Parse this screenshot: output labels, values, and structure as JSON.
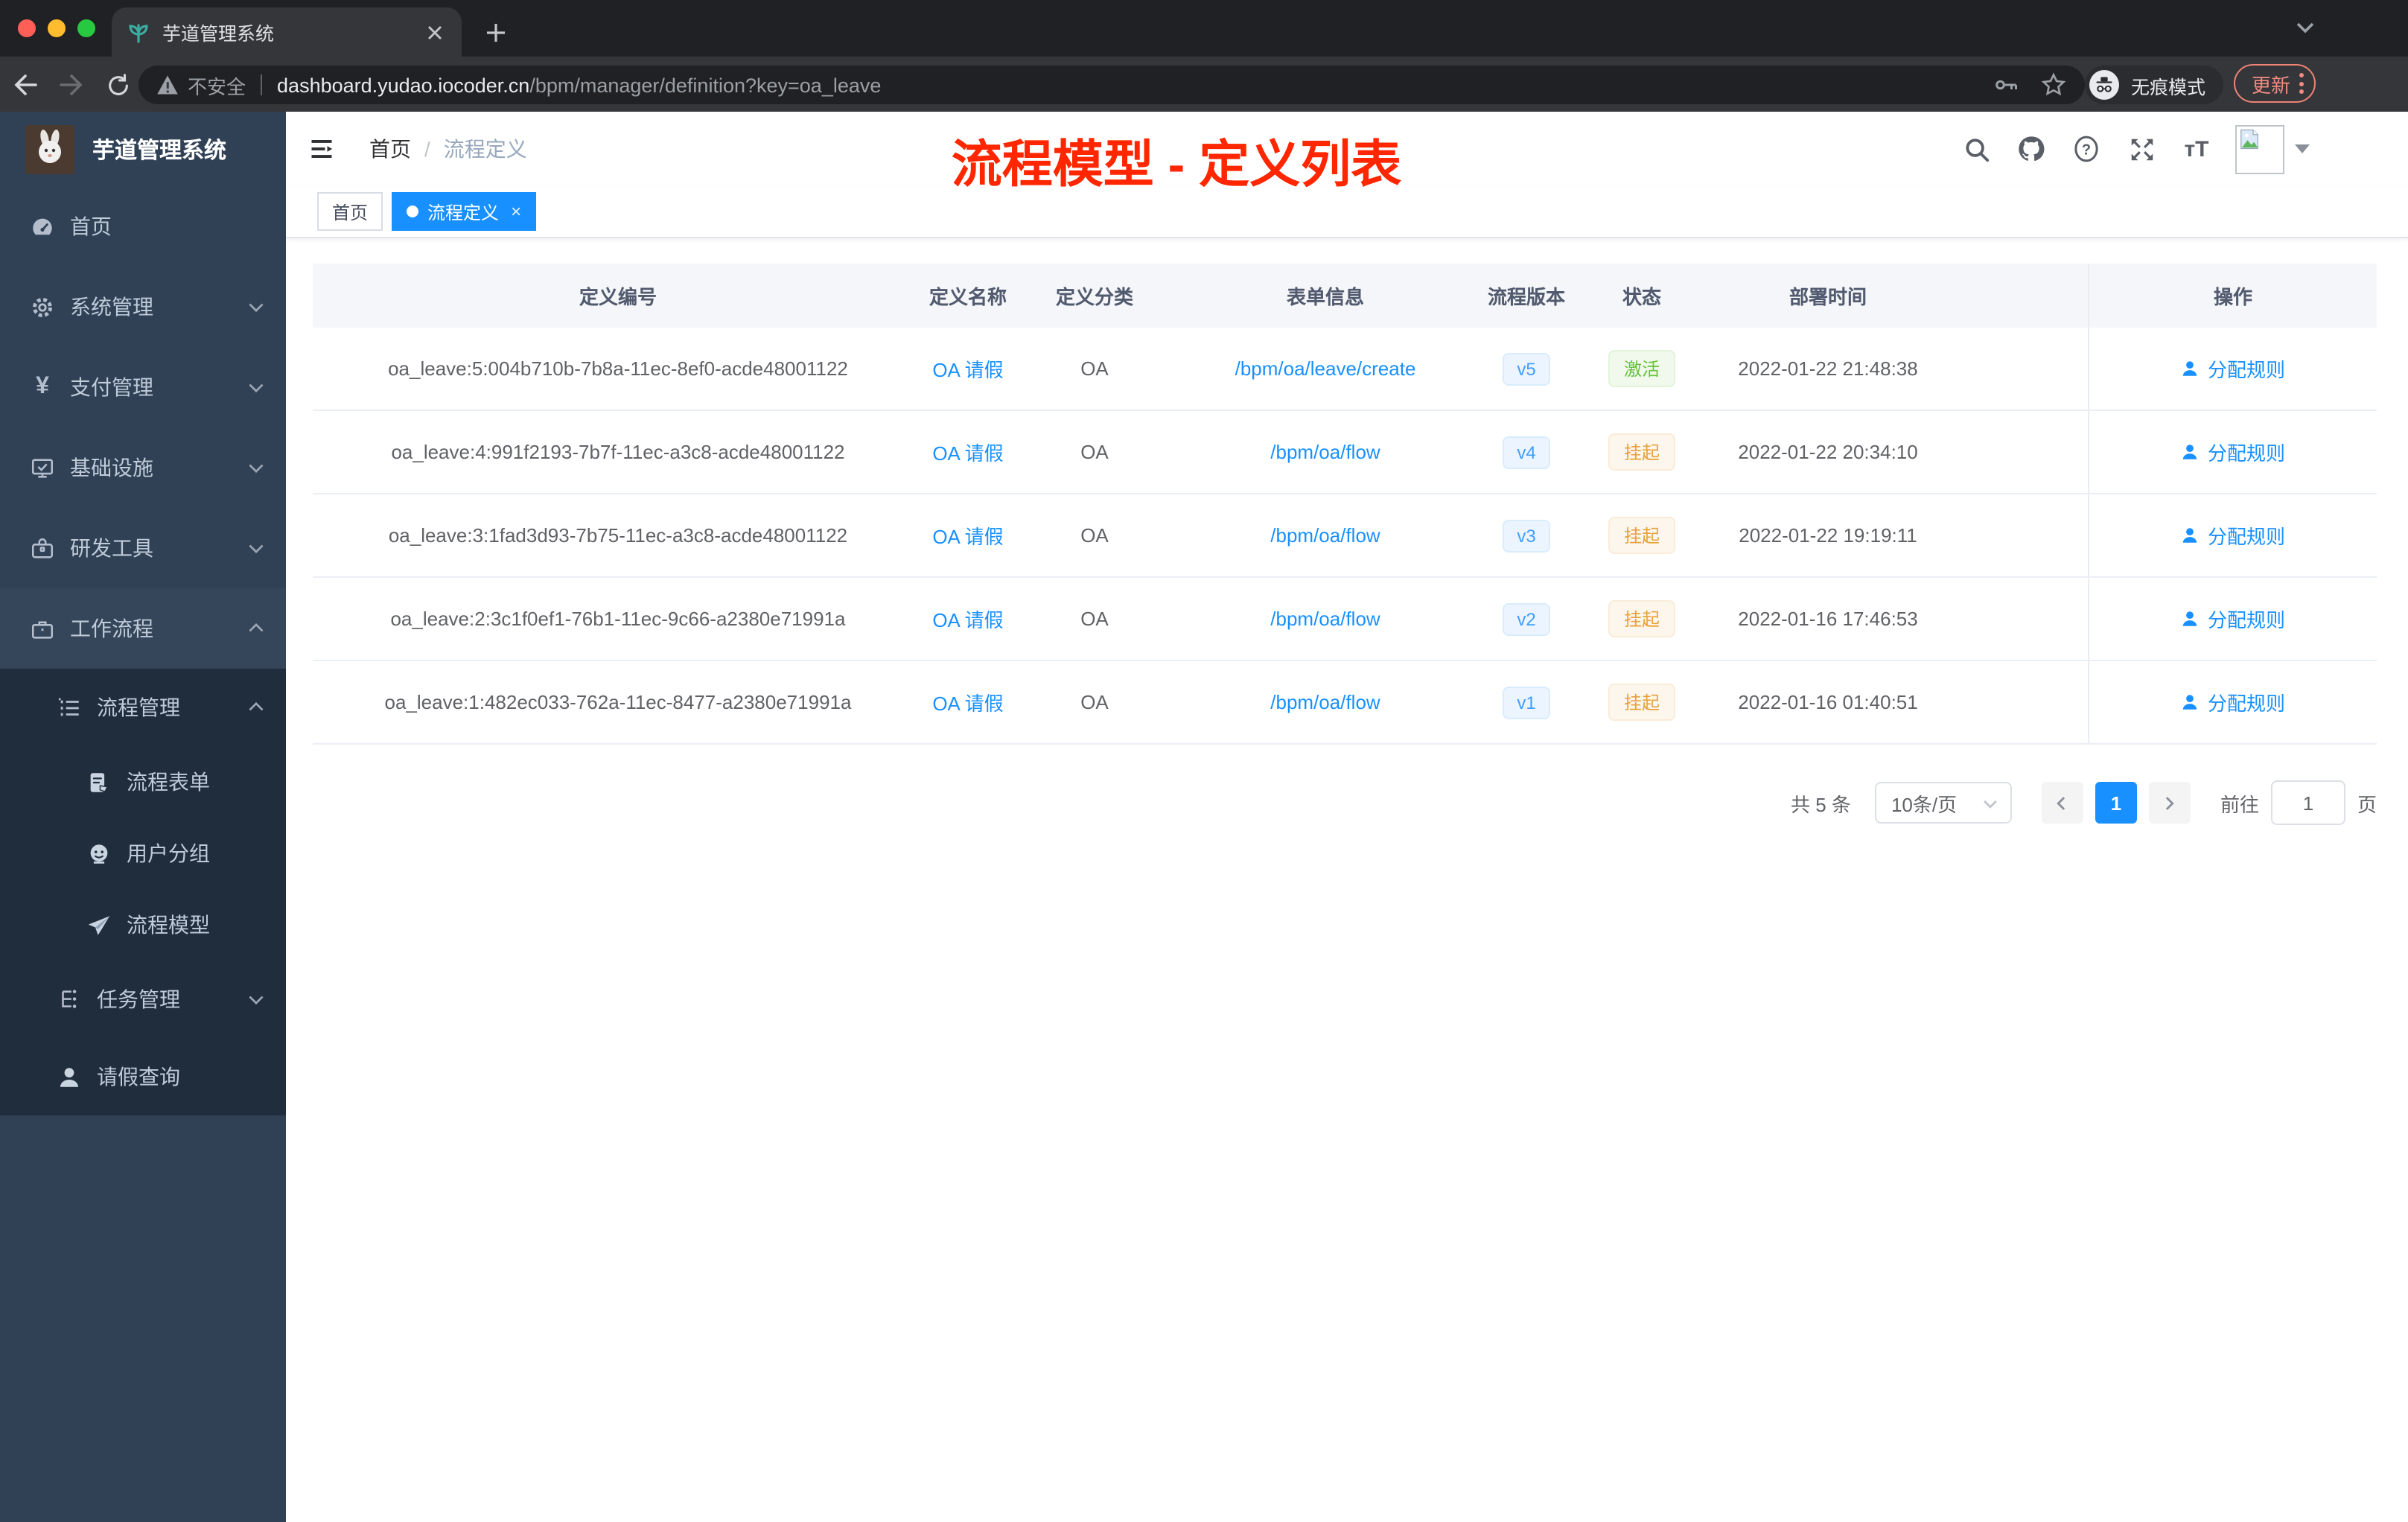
{
  "colors": {
    "accent": "#1890ff",
    "success": "#67c23a",
    "warning": "#e6a23c",
    "annotation_red": "#ff2600",
    "sidebar_bg": "#304156",
    "submenu_bg": "#1f2d3d"
  },
  "browser": {
    "tab_title": "芋道管理系统",
    "security_label": "不安全",
    "url_domain": "dashboard.yudao.iocoder.cn",
    "url_path": "/bpm/manager/definition?key=oa_leave",
    "incognito_label": "无痕模式",
    "update_label": "更新"
  },
  "annotation": {
    "title": "流程模型 - 定义列表"
  },
  "sidebar": {
    "app_title": "芋道管理系统",
    "items": [
      {
        "label": "首页",
        "icon": "dashboard-icon"
      },
      {
        "label": "系统管理",
        "icon": "gear-icon",
        "chevron": "down"
      },
      {
        "label": "支付管理",
        "icon": "yen-icon",
        "chevron": "down"
      },
      {
        "label": "基础设施",
        "icon": "monitor-icon",
        "chevron": "down"
      },
      {
        "label": "研发工具",
        "icon": "toolbox-icon",
        "chevron": "down"
      },
      {
        "label": "工作流程",
        "icon": "briefcase-icon",
        "chevron": "up"
      },
      {
        "label": "流程管理",
        "icon": "list-icon",
        "chevron": "up"
      },
      {
        "label": "流程表单",
        "icon": "form-icon"
      },
      {
        "label": "用户分组",
        "icon": "robot-icon"
      },
      {
        "label": "流程模型",
        "icon": "paper-plane-icon"
      },
      {
        "label": "任务管理",
        "icon": "tasks-icon",
        "chevron": "down"
      },
      {
        "label": "请假查询",
        "icon": "user-icon"
      }
    ]
  },
  "navbar": {
    "breadcrumb_home": "首页",
    "breadcrumb_separator": "/",
    "breadcrumb_current": "流程定义"
  },
  "tags": [
    {
      "label": "首页",
      "active": false
    },
    {
      "label": "流程定义",
      "active": true,
      "closable": true
    }
  ],
  "table": {
    "headers": [
      "定义编号",
      "定义名称",
      "定义分类",
      "表单信息",
      "流程版本",
      "状态",
      "部署时间",
      "操作"
    ],
    "action_label": "分配规则",
    "rows": [
      {
        "id": "oa_leave:5:004b710b-7b8a-11ec-8ef0-acde48001122",
        "name": "OA 请假",
        "category": "OA",
        "form": "/bpm/oa/leave/create",
        "version": "v5",
        "status": "激活",
        "status_type": "success",
        "deploy_time": "2022-01-22 21:48:38"
      },
      {
        "id": "oa_leave:4:991f2193-7b7f-11ec-a3c8-acde48001122",
        "name": "OA 请假",
        "category": "OA",
        "form": "/bpm/oa/flow",
        "version": "v4",
        "status": "挂起",
        "status_type": "warning",
        "deploy_time": "2022-01-22 20:34:10"
      },
      {
        "id": "oa_leave:3:1fad3d93-7b75-11ec-a3c8-acde48001122",
        "name": "OA 请假",
        "category": "OA",
        "form": "/bpm/oa/flow",
        "version": "v3",
        "status": "挂起",
        "status_type": "warning",
        "deploy_time": "2022-01-22 19:19:11"
      },
      {
        "id": "oa_leave:2:3c1f0ef1-76b1-11ec-9c66-a2380e71991a",
        "name": "OA 请假",
        "category": "OA",
        "form": "/bpm/oa/flow",
        "version": "v2",
        "status": "挂起",
        "status_type": "warning",
        "deploy_time": "2022-01-16 17:46:53"
      },
      {
        "id": "oa_leave:1:482ec033-762a-11ec-8477-a2380e71991a",
        "name": "OA 请假",
        "category": "OA",
        "form": "/bpm/oa/flow",
        "version": "v1",
        "status": "挂起",
        "status_type": "warning",
        "deploy_time": "2022-01-16 01:40:51"
      }
    ]
  },
  "pagination": {
    "total": "共 5 条",
    "page_size": "10条/页",
    "current": "1",
    "goto_label": "前往",
    "goto_value": "1",
    "unit": "页"
  }
}
